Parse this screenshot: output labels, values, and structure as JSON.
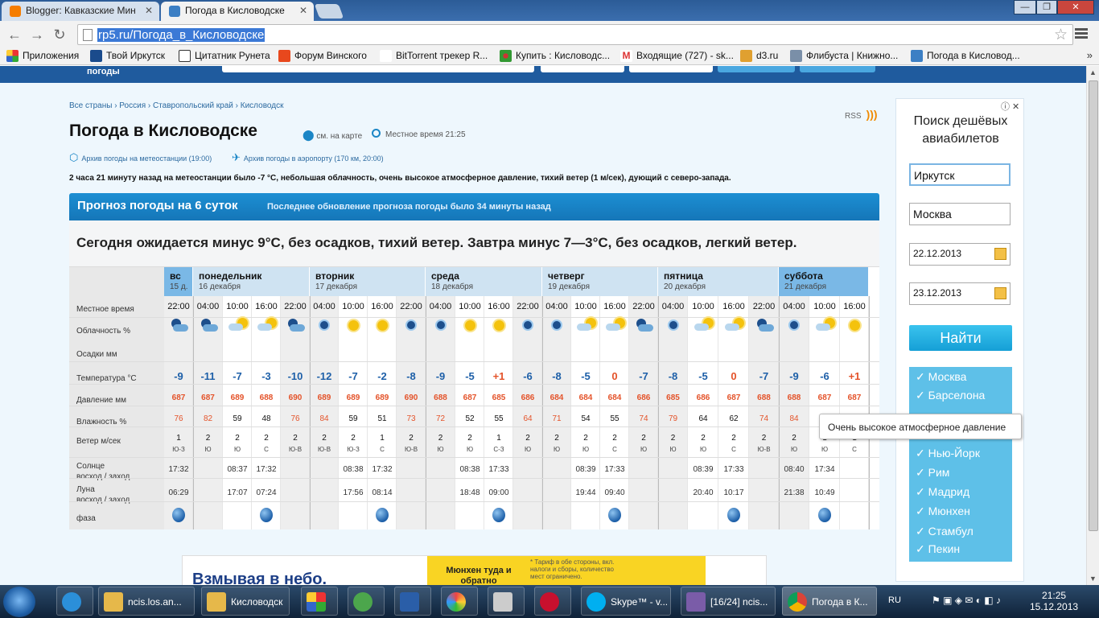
{
  "browser": {
    "tabs": [
      {
        "title": "Blogger: Кавказские Мин"
      },
      {
        "title": "Погода в Кисловодске"
      }
    ],
    "url": "rp5.ru/Погода_в_Кисловодске",
    "bookmarks": [
      "Приложения",
      "Твой Иркутск",
      "Цитатник Рунета",
      "Форум Винского",
      "BitTorrent трекер R...",
      "Купить : Кисловодс...",
      "Входящие (727) - sk...",
      "d3.ru",
      "Флибуста | Книжно...",
      "Погода в Кисловод..."
    ],
    "bookmarks_more": "»"
  },
  "site": {
    "header_logo": "погоды"
  },
  "breadcrumbs": "Все страны › Россия › Ставропольский край › Кисловодск",
  "rss_label": "RSS",
  "page_title": "Погода в Кисловодске",
  "map_link": "см. на карте",
  "local_time": "Местное время  21:25",
  "archive_station": "Архив погоды на метеостанции (19:00)",
  "archive_airport": "Архив погоды в аэропорту (170 км, 20:00)",
  "current_description": "2 часа 21 минуту назад на метеостанции было -7 °С, небольшая облачность, очень высокое атмосферное давление, тихий ветер (1 м/сек), дующий с северо-запада.",
  "forecast": {
    "title": "Прогноз погоды на 6 суток",
    "updated": "Последнее обновление прогноза погоды было 34 минуты назад",
    "summary": "Сегодня ожидается минус 9°C, без осадков, тихий ветер. Завтра минус 7—3°C, без осадков, легкий ветер.",
    "row_labels": {
      "time": "Местное время",
      "clouds": "Облачность %",
      "precip": "Осадки мм",
      "temp": "Температура °С",
      "pressure": "Давление мм",
      "humidity": "Влажность %",
      "wind": "Ветер м/сек",
      "sun": "Солнце",
      "sun2": "восход / заход",
      "moon": "Луна",
      "moon2": "восход / заход",
      "phase": "фаза"
    },
    "days": [
      {
        "name": "вс",
        "date": "15 д."
      },
      {
        "name": "понедельник",
        "date": "16 декабря"
      },
      {
        "name": "вторник",
        "date": "17 декабря"
      },
      {
        "name": "среда",
        "date": "18 декабря"
      },
      {
        "name": "четверг",
        "date": "19 декабря"
      },
      {
        "name": "пятница",
        "date": "20 декабря"
      },
      {
        "name": "суббота",
        "date": "21 декабря"
      }
    ],
    "times": [
      "22:00",
      "04:00",
      "10:00",
      "16:00",
      "22:00",
      "04:00",
      "10:00",
      "16:00",
      "22:00",
      "04:00",
      "10:00",
      "16:00",
      "22:00",
      "04:00",
      "10:00",
      "16:00",
      "22:00",
      "04:00",
      "10:00",
      "16:00",
      "22:00",
      "04:00",
      "10:00",
      "16:00"
    ],
    "temps": [
      "-9",
      "-11",
      "-7",
      "-3",
      "-10",
      "-12",
      "-7",
      "-2",
      "-8",
      "-9",
      "-5",
      "+1",
      "-6",
      "-8",
      "-5",
      "0",
      "-7",
      "-8",
      "-5",
      "0",
      "-7",
      "-9",
      "-6",
      "+1"
    ],
    "pressure": [
      "687",
      "687",
      "689",
      "688",
      "690",
      "689",
      "689",
      "689",
      "690",
      "688",
      "687",
      "685",
      "686",
      "684",
      "684",
      "684",
      "686",
      "685",
      "686",
      "687",
      "688",
      "688",
      "687",
      "687"
    ],
    "humidity": [
      "76",
      "82",
      "59",
      "48",
      "76",
      "84",
      "59",
      "51",
      "73",
      "72",
      "52",
      "55",
      "64",
      "71",
      "54",
      "55",
      "74",
      "79",
      "64",
      "62",
      "74",
      "84",
      "",
      ""
    ],
    "wind_speed": [
      "1",
      "2",
      "2",
      "2",
      "2",
      "2",
      "2",
      "1",
      "2",
      "2",
      "2",
      "1",
      "2",
      "2",
      "2",
      "2",
      "2",
      "2",
      "2",
      "2",
      "2",
      "2",
      "1",
      "1"
    ],
    "wind_dir": [
      "Ю-З",
      "Ю",
      "Ю",
      "С",
      "Ю-В",
      "Ю-В",
      "Ю-З",
      "С",
      "Ю-В",
      "Ю",
      "Ю",
      "С-З",
      "Ю",
      "Ю",
      "Ю",
      "С",
      "Ю",
      "Ю",
      "Ю",
      "С",
      "Ю-В",
      "Ю",
      "Ю",
      "С"
    ],
    "sun": [
      {
        "col": 0,
        "text": "17:32"
      },
      {
        "col": 2,
        "text": "08:37"
      },
      {
        "col": 3,
        "text": "17:32"
      },
      {
        "col": 6,
        "text": "08:38"
      },
      {
        "col": 7,
        "text": "17:32"
      },
      {
        "col": 10,
        "text": "08:38"
      },
      {
        "col": 11,
        "text": "17:33"
      },
      {
        "col": 14,
        "text": "08:39"
      },
      {
        "col": 15,
        "text": "17:33"
      },
      {
        "col": 18,
        "text": "08:39"
      },
      {
        "col": 19,
        "text": "17:33"
      },
      {
        "col": 21,
        "text": "08:40"
      },
      {
        "col": 22,
        "text": "17:34"
      }
    ],
    "moon": [
      {
        "col": 0,
        "text": "06:29"
      },
      {
        "col": 2,
        "text": "17:07"
      },
      {
        "col": 3,
        "text": "07:24"
      },
      {
        "col": 6,
        "text": "17:56"
      },
      {
        "col": 7,
        "text": "08:14"
      },
      {
        "col": 10,
        "text": "18:48"
      },
      {
        "col": 11,
        "text": "09:00"
      },
      {
        "col": 14,
        "text": "19:44"
      },
      {
        "col": 15,
        "text": "09:40"
      },
      {
        "col": 18,
        "text": "20:40"
      },
      {
        "col": 19,
        "text": "10:17"
      },
      {
        "col": 21,
        "text": "21:38"
      },
      {
        "col": 22,
        "text": "10:49"
      }
    ],
    "phase_cols": [
      0,
      3,
      7,
      11,
      15,
      19,
      22
    ],
    "icons": [
      "cloud-moon",
      "cloud-moon",
      "sun-cloud",
      "sun-cloud",
      "cloud-moon",
      "moon",
      "sun",
      "sun",
      "moon",
      "moon",
      "sun",
      "sun",
      "moon",
      "moon",
      "sun-cloud",
      "sun-cloud",
      "cloud-moon",
      "moon",
      "sun-cloud",
      "sun-cloud",
      "cloud-moon",
      "moon",
      "sun-cloud",
      "sun"
    ]
  },
  "ad": {
    "heading": "Поиск дешёвых авиабилетов",
    "from": "Иркутск",
    "to": "Москва",
    "date1": "22.12.2013",
    "date2": "23.12.2013",
    "search": "Найти",
    "cities": [
      "✓ Москва",
      "✓ Барселона",
      "✓ Нью-Йорк",
      "✓ Рим",
      "✓ Мадрид",
      "✓ Мюнхен",
      "✓ Стамбул",
      "✓ Пекин"
    ]
  },
  "tooltip": "Очень высокое атмосферное давление",
  "banner": {
    "headline": "Взмывая в небо.",
    "promo": "Мюнхен туда и обратно",
    "fine": "* Тариф в обе стороны, вкл. налоги и сборы, количество мест ограничено."
  },
  "taskbar": {
    "items": [
      "ncis.los.an...",
      "Кисловодск",
      "",
      "",
      "",
      "",
      "",
      "",
      "Skype™ - v...",
      "[16/24] ncis...",
      "Погода в К..."
    ],
    "lang": "RU",
    "time": "21:25",
    "date": "15.12.2013"
  },
  "colors": {
    "accent": "#1576b8",
    "pressure": "#e4532a",
    "minus": "#1d5fa8",
    "plus": "#e4532a"
  }
}
